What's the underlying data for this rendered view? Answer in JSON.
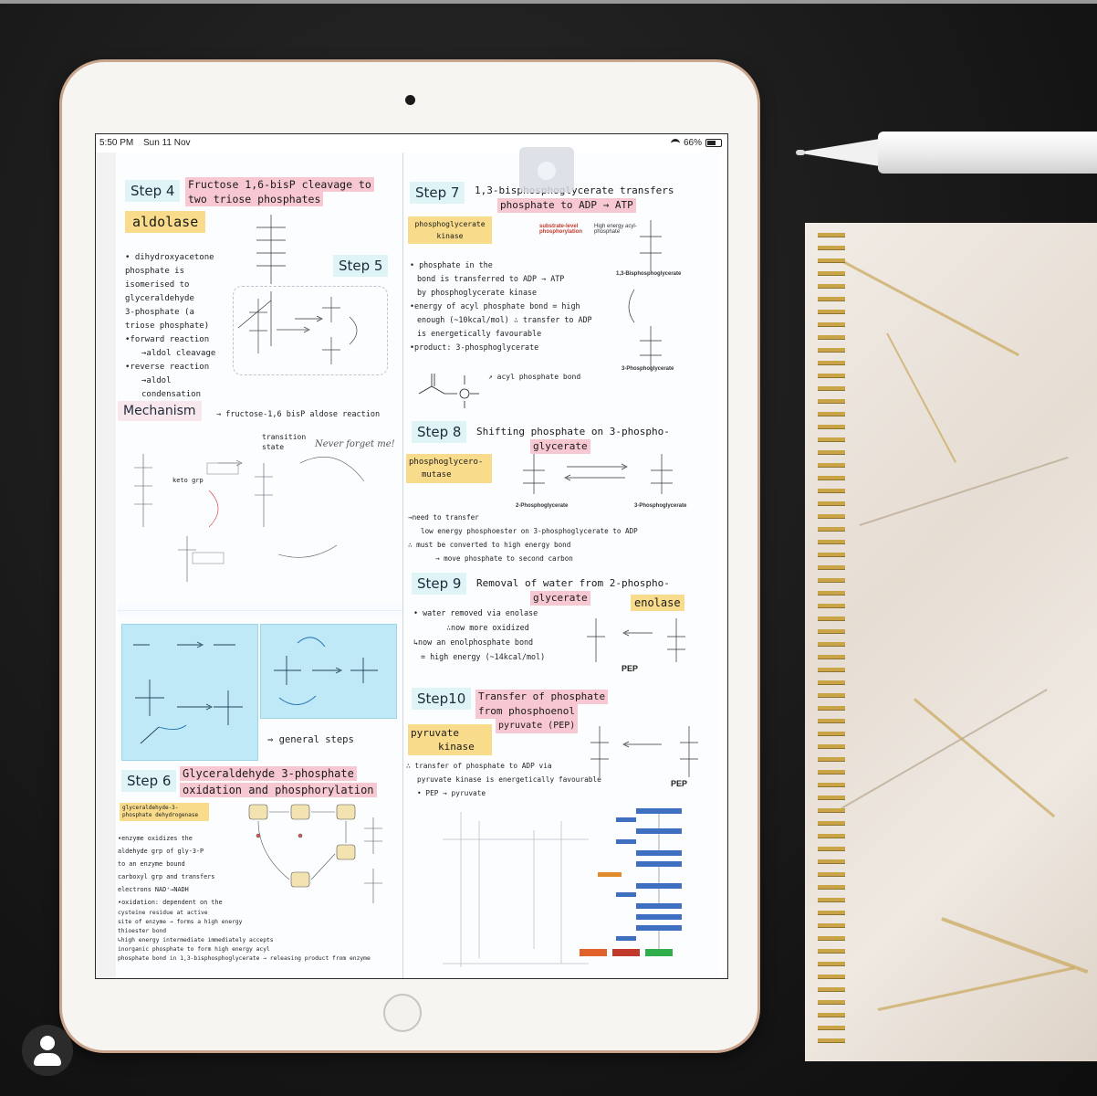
{
  "status_bar": {
    "time": "5:50 PM",
    "date": "Sun 11 Nov",
    "battery": "66%"
  },
  "notes": {
    "step4": {
      "label": "Step 4",
      "title_line1": "Fructose 1,6-bisP cleavage to",
      "title_line2": "two triose phosphates",
      "enzyme": "aldolase",
      "bullets": [
        "• dihydroxyacetone",
        "phosphate is",
        "isomerised to",
        "glyceraldehyde",
        "3-phosphate (a",
        "triose phosphate)",
        "•forward reaction",
        "→aldol cleavage",
        "•reverse reaction",
        "→aldol condensation"
      ]
    },
    "step5": {
      "label": "Step 5"
    },
    "mechanism": {
      "label": "Mechanism",
      "subtitle": "→ fructose-1,6 bisP aldose reaction",
      "transition": "transition state",
      "never_forget": "Never forget me!",
      "keto_grp": "keto grp",
      "general_steps": "⇒ general steps"
    },
    "step6": {
      "label": "Step 6",
      "title_line1": "Glyceraldehyde 3-phosphate",
      "title_line2": "oxidation and phosphorylation",
      "enzyme": "glyceraldehyde-3-phosphate dehydrogenase",
      "bullets": [
        "•enzyme oxidizes the",
        "aldehyde grp of gly-3-P",
        "to an enzyme bound",
        "carboxyl grp and transfers",
        "electrons NAD⁺→NADH",
        "•oxidation: dependent on the",
        "cysteine residue at active",
        "site of enzyme → forms a high energy",
        "thioester bond",
        "↳high energy intermediate immediately accepts",
        "inorganic phosphate to form high energy acyl",
        "phosphate bond in 1,3-bisphosphoglycerate → releasing product from enzyme"
      ]
    },
    "step7": {
      "label": "Step 7",
      "title_line1": "1,3-bisphosphoglycerate transfers",
      "title_line2": "phosphate to ADP → ATP",
      "enzyme_line1": "phosphoglycerate",
      "enzyme_line2": "kinase",
      "substrate_level": "substrate-level phosphorylation",
      "high_energy": "High energy acyl-phosphate",
      "bullets": [
        "• phosphate in the",
        "bond is transferred to ADP → ATP",
        "by phosphoglycerate kinase",
        "•energy of acyl phosphate bond = high",
        "enough (~10kcal/mol) ∴ transfer to ADP",
        "is energetically favourable",
        "•product: 3-phosphoglycerate"
      ],
      "acyl_label": "↗ acyl phosphate bond",
      "compound_top": "1,3-Bisphosphoglycerate",
      "compound_bottom": "3-Phosphoglycerate"
    },
    "step8": {
      "label": "Step 8",
      "title_line1": "Shifting phosphate on 3-phospho-",
      "title_line2": "glycerate",
      "enzyme_line1": "phosphoglycero-",
      "enzyme_line2": "mutase",
      "left_compound": "2-Phosphoglycerate",
      "right_compound": "3-Phosphoglycerate",
      "bullets": [
        "→need to transfer",
        "low energy phosphoester on 3-phosphoglycerate to ADP",
        "∴ must be converted to high energy bond",
        "→ move phosphate to second carbon"
      ]
    },
    "step9": {
      "label": "Step 9",
      "title_line1": "Removal of water from 2-phospho-",
      "title_line2": "glycerate",
      "enzyme": "enolase",
      "bullets": [
        "• water removed via enolase",
        "∴now more oxidized",
        "↳now an enolphosphate bond",
        "= high energy (~14kcal/mol)"
      ],
      "pep": "PEP"
    },
    "step10": {
      "label": "Step10",
      "title_line1": "Transfer of phosphate",
      "title_line2": "from phosphoenol",
      "title_line3": "pyruvate (PEP)",
      "enzyme_line1": "pyruvate",
      "enzyme_line2": "kinase",
      "bullets": [
        "∴ transfer of phosphate to ADP via",
        "pyruvate kinase is energetically favourable",
        "• PEP → pyruvate"
      ],
      "pep": "PEP"
    }
  },
  "colors": {
    "step_label_bg": "#dff4f7",
    "title_highlight": "#f7c8d2",
    "enzyme_highlight": "#f8dc8c",
    "card_blue": "#bfe9f6",
    "ipad_frame": "#f7f5f2",
    "rose_gold": "#c9a58d",
    "desk": "#151515"
  }
}
